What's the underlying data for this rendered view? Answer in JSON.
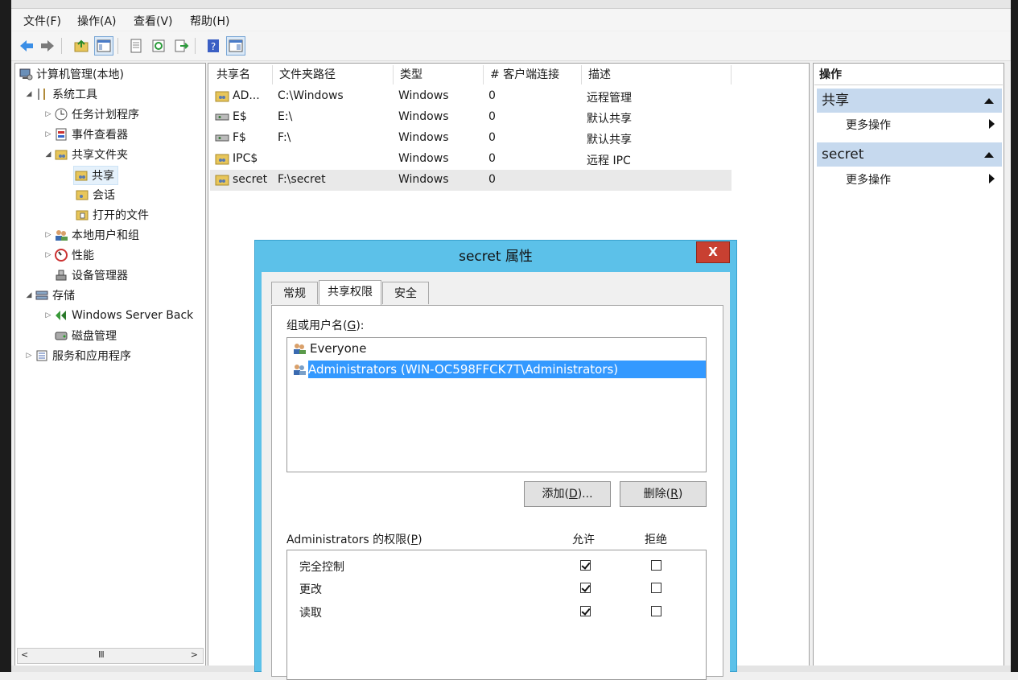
{
  "menubar": {
    "items": [
      "文件(F)",
      "操作(A)",
      "查看(V)",
      "帮助(H)"
    ]
  },
  "toolbar": {
    "buttons": [
      "back-icon",
      "forward-icon",
      "up-folder-icon",
      "show-tree-icon",
      "properties-icon",
      "refresh-icon",
      "export-icon",
      "help-icon",
      "show-action-pane-icon"
    ]
  },
  "tree": {
    "root": "计算机管理(本地)",
    "system_tools": "系统工具",
    "task_scheduler": "任务计划程序",
    "event_viewer": "事件查看器",
    "shared_folders": "共享文件夹",
    "shares": "共享",
    "sessions": "会话",
    "open_files": "打开的文件",
    "local_users": "本地用户和组",
    "performance": "性能",
    "device_manager": "设备管理器",
    "storage": "存储",
    "windows_backup": "Windows Server Back",
    "disk_management": "磁盘管理",
    "services": "服务和应用程序",
    "scroll_thumb": "III"
  },
  "list": {
    "columns": [
      "共享名",
      "文件夹路径",
      "类型",
      "# 客户端连接",
      "描述"
    ],
    "rows": [
      {
        "name": "AD...",
        "path": "C:\\Windows",
        "type": "Windows",
        "clients": "0",
        "desc": "远程管理"
      },
      {
        "name": "E$",
        "path": "E:\\",
        "type": "Windows",
        "clients": "0",
        "desc": "默认共享"
      },
      {
        "name": "F$",
        "path": "F:\\",
        "type": "Windows",
        "clients": "0",
        "desc": "默认共享"
      },
      {
        "name": "IPC$",
        "path": "",
        "type": "Windows",
        "clients": "0",
        "desc": "远程 IPC"
      },
      {
        "name": "secret",
        "path": "F:\\secret",
        "type": "Windows",
        "clients": "0",
        "desc": ""
      }
    ]
  },
  "actions": {
    "title": "操作",
    "section1": "共享",
    "section1_item": "更多操作",
    "section2": "secret",
    "section2_item": "更多操作"
  },
  "dialog": {
    "title": "secret 属性",
    "close": "X",
    "tabs": [
      "常规",
      "共享权限",
      "安全"
    ],
    "group_label_prefix": "组或用户名(",
    "group_label_key": "G",
    "group_label_suffix": "):",
    "users": [
      "Everyone",
      "Administrators (WIN-OC598FFCK7T\\Administrators)"
    ],
    "add_prefix": "添加(",
    "add_key": "D",
    "add_suffix": ")...",
    "remove_prefix": "删除(",
    "remove_key": "R",
    "remove_suffix": ")",
    "perm_label_prefix": "Administrators 的权限(",
    "perm_label_key": "P",
    "perm_label_suffix": ")",
    "allow": "允许",
    "deny": "拒绝",
    "permissions": [
      {
        "name": "完全控制",
        "allow": true,
        "deny": false
      },
      {
        "name": "更改",
        "allow": true,
        "deny": false
      },
      {
        "name": "读取",
        "allow": true,
        "deny": false
      }
    ]
  }
}
